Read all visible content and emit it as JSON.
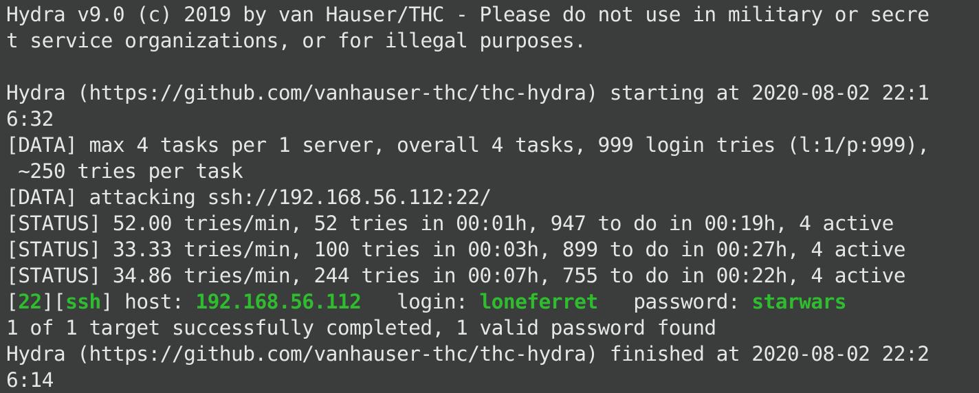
{
  "colors": {
    "background": "#3b3d3d",
    "text": "#e6e6e6",
    "highlight": "#2fbd2f"
  },
  "terminal": {
    "lines": [
      "Hydra v9.0 (c) 2019 by van Hauser/THC - Please do not use in military or secre",
      "t service organizations, or for illegal purposes.",
      "",
      "Hydra (https://github.com/vanhauser-thc/thc-hydra) starting at 2020-08-02 22:1",
      "6:32",
      "[DATA] max 4 tasks per 1 server, overall 4 tasks, 999 login tries (l:1/p:999),",
      " ~250 tries per task",
      "[DATA] attacking ssh://192.168.56.112:22/",
      "[STATUS] 52.00 tries/min, 52 tries in 00:01h, 947 to do in 00:19h, 4 active",
      "[STATUS] 33.33 tries/min, 100 tries in 00:03h, 899 to do in 00:27h, 4 active",
      "[STATUS] 34.86 tries/min, 244 tries in 00:07h, 755 to do in 00:22h, 4 active"
    ],
    "result": {
      "open_bracket_1": "[",
      "port": "22",
      "mid_bracket": "][",
      "service": "ssh",
      "host_label": "] host: ",
      "host": "192.168.56.112",
      "login_label": "   login: ",
      "login": "loneferret",
      "password_label": "   password: ",
      "password": "starwars"
    },
    "tail_lines": [
      "1 of 1 target successfully completed, 1 valid password found",
      "Hydra (https://github.com/vanhauser-thc/thc-hydra) finished at 2020-08-02 22:2",
      "6:14"
    ]
  }
}
